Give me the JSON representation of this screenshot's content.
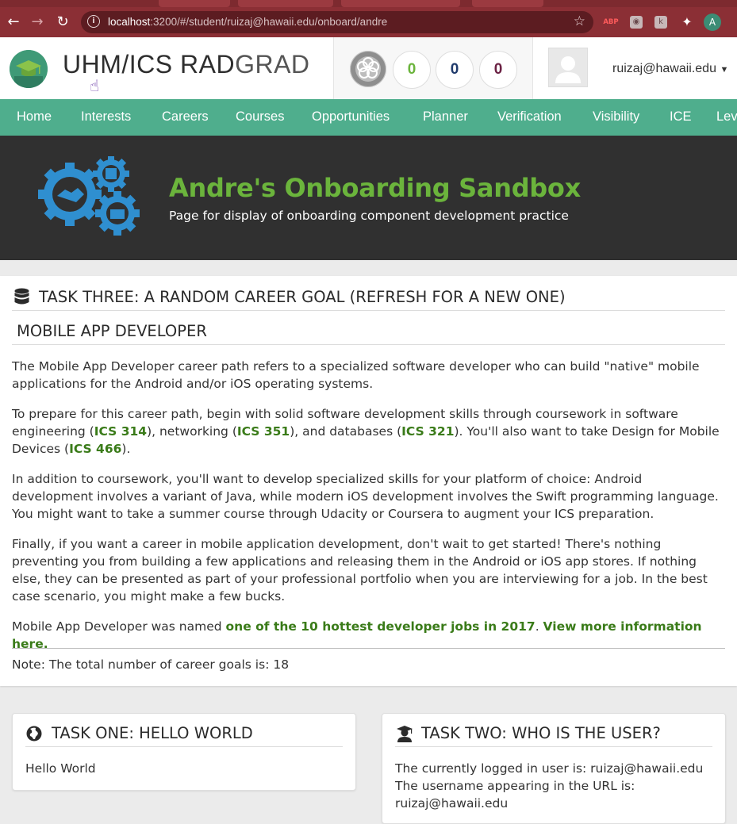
{
  "browser": {
    "url_host": "localhost",
    "url_rest": ":3200/#/student/ruizaj@hawaii.edu/onboard/andre",
    "profile_initial": "A",
    "ext_abp": "ABP",
    "ext_k": "k"
  },
  "header": {
    "logo_main": "UHM/ICS RAD",
    "logo_light": "GRAD",
    "counters": [
      {
        "value": "0",
        "color": "#6bb43c"
      },
      {
        "value": "0",
        "color": "#1f3a6b"
      },
      {
        "value": "0",
        "color": "#6b2244"
      }
    ],
    "user_email": "ruizaj@hawaii.edu"
  },
  "nav": {
    "items": [
      "Home",
      "Interests",
      "Careers",
      "Courses",
      "Opportunities",
      "Planner",
      "Verification",
      "Visibility",
      "ICE",
      "Lev"
    ]
  },
  "banner": {
    "title": "Andre's Onboarding Sandbox",
    "subtitle": "Page for display of onboarding component development practice"
  },
  "task_three": {
    "header": "TASK THREE: A RANDOM CAREER GOAL (REFRESH FOR A NEW ONE)",
    "goal_name": "MOBILE APP DEVELOPER",
    "p1": "The Mobile App Developer career path refers to a specialized software developer who can build \"native\" mobile applications for the Android and/or iOS operating systems.",
    "p2": {
      "t1": "To prepare for this career path, begin with solid software development skills through coursework in software engineering (",
      "c1": "ICS 314",
      "t2": "), networking (",
      "c2": "ICS 351",
      "t3": "), and databases (",
      "c3": "ICS 321",
      "t4": "). You'll also want to take Design for Mobile Devices (",
      "c4": "ICS 466",
      "t5": ")."
    },
    "p3": "In addition to coursework, you'll want to develop specialized skills for your platform of choice: Android development involves a variant of Java, while modern iOS development involves the Swift programming language. You might want to take a summer course through Udacity or Coursera to augment your ICS preparation.",
    "p4": "Finally, if you want a career in mobile application development, don't wait to get started! There's nothing preventing you from building a few applications and releasing them in the Android or iOS app stores. If nothing else, they can be presented as part of your professional portfolio when you are interviewing for a job. In the best case scenario, you might make a few bucks.",
    "p5": {
      "t1": "Mobile App Developer was named ",
      "l1": "one of the 10 hottest developer jobs in 2017",
      "t2": ". ",
      "l2": "View more information here."
    },
    "note": "Note: The total number of career goals is: 18"
  },
  "task_one": {
    "header": "TASK ONE: HELLO WORLD",
    "body": "Hello World"
  },
  "task_two": {
    "header": "TASK TWO: WHO IS THE USER?",
    "line1": "The currently logged in user is: ruizaj@hawaii.edu",
    "line2": "The username appearing in the URL is:",
    "line3": "ruizaj@hawaii.edu"
  },
  "colors": {
    "nav_green": "#4fae8d",
    "banner_title_green": "#6bb43c",
    "link_green": "#3a7b19",
    "chrome_red": "#8b2f35"
  }
}
